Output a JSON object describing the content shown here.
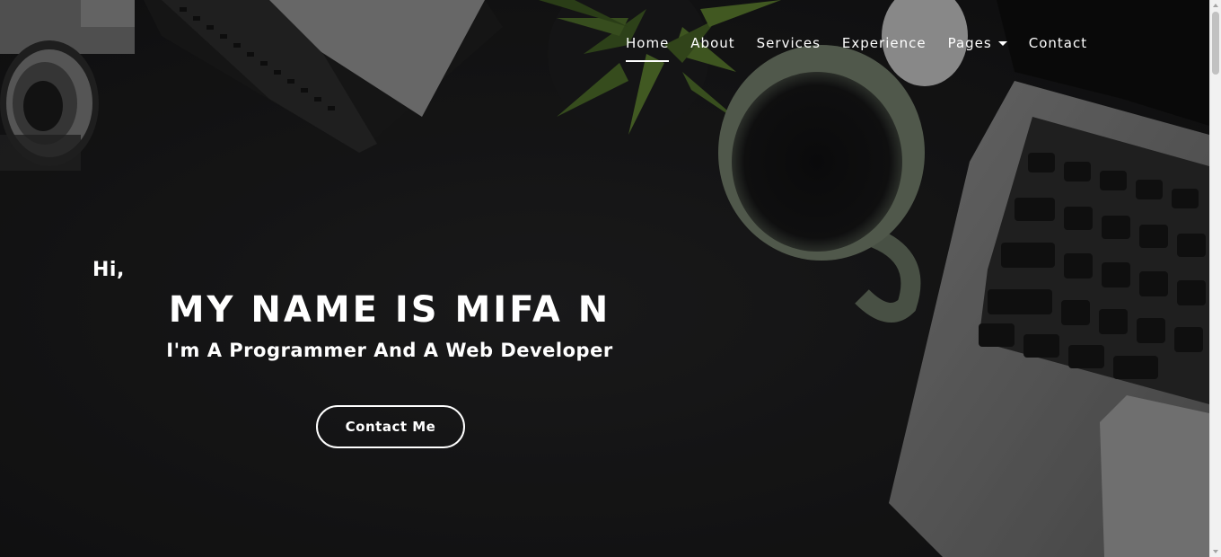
{
  "nav": {
    "items": [
      {
        "label": "Home",
        "active": true
      },
      {
        "label": "About"
      },
      {
        "label": "Services"
      },
      {
        "label": "Experience"
      },
      {
        "label": "Pages",
        "dropdown": true
      },
      {
        "label": "Contact"
      }
    ]
  },
  "hero": {
    "greeting": "Hi,",
    "title": "MY NAME IS MIFA N",
    "subtitle": "I'm A Programmer And A Web Developer",
    "cta_label": "Contact Me"
  },
  "colors": {
    "text": "#ffffff",
    "background": "#1c1c1d"
  }
}
